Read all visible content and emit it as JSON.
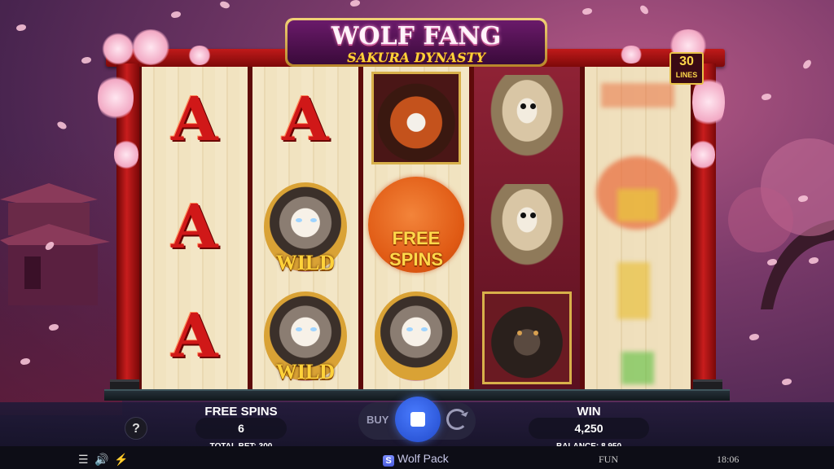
{
  "game": {
    "title": "WOLF FANG",
    "subtitle": "SAKURA DYNASTY",
    "lines_badge": {
      "number": "30",
      "label": "LINES"
    }
  },
  "reels": [
    {
      "symbols": [
        "A",
        "A",
        "A"
      ]
    },
    {
      "symbols": [
        "A",
        "WILD",
        "WILD"
      ]
    },
    {
      "symbols": [
        "red-panda",
        "FREE SPINS",
        "WILD"
      ]
    },
    {
      "symbols": [
        "sugar-glider",
        "sugar-glider",
        "bear"
      ]
    },
    {
      "symbols": [
        "blurred",
        "blurred",
        "blurred"
      ]
    }
  ],
  "scatter_text": {
    "line1": "FREE",
    "line2": "SPINS"
  },
  "wild_text": "WILD",
  "hud": {
    "free_spins_label": "FREE SPINS",
    "free_spins_value": "6",
    "total_bet_label": "TOTAL BET: 300",
    "buy_label": "BUY",
    "win_label": "WIN",
    "win_value": "4,250",
    "balance_label": "BALANCE: 8,950",
    "help_label": "?"
  },
  "status_bar": {
    "brand": "Wolf Pack",
    "brand_letter": "S",
    "mode": "FUN",
    "time": "18:06"
  },
  "colors": {
    "accent_blue": "#2f5fe8",
    "torii_red": "#c01a1a",
    "gold": "#ffd23a"
  }
}
